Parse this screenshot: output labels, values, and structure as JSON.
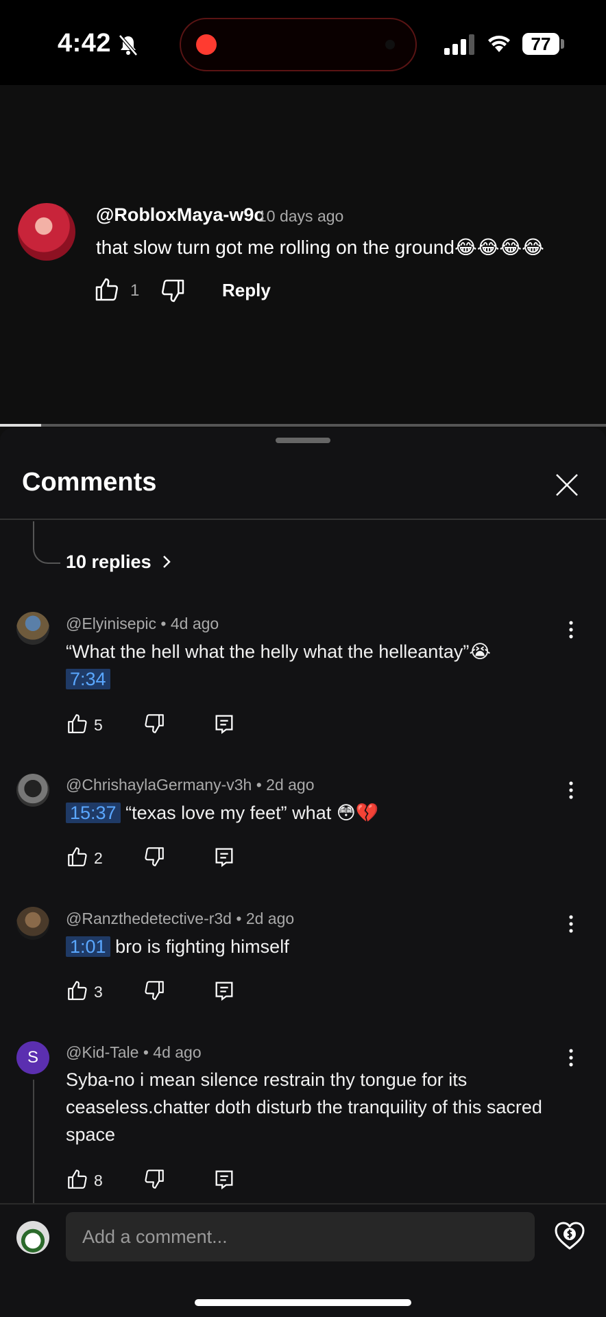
{
  "status_bar": {
    "time": "4:42",
    "battery": "77"
  },
  "video_comment": {
    "username": "@RobloxMaya-w9c",
    "time": "10 days ago",
    "text": "that slow turn got me rolling on the ground😂😂😂😂",
    "like_count": "1",
    "reply_label": "Reply"
  },
  "comments_sheet": {
    "title": "Comments",
    "replies_link": "10 replies",
    "comments": [
      {
        "username": "@Elyinisepic",
        "time": "4d ago",
        "text": "“What the hell what the helly what the helleantay”😭",
        "timestamp": "7:34",
        "likes": "5"
      },
      {
        "username": "@ChrishaylaGermany-v3h",
        "time": "2d ago",
        "timestamp": "15:37",
        "text": "“texas love my feet” what 😳💔",
        "likes": "2"
      },
      {
        "username": "@Ranzthedetective-r3d",
        "time": "2d ago",
        "timestamp": "1:01",
        "text": "bro is fighting himself",
        "likes": "3"
      },
      {
        "username": "@Kid-Tale",
        "time": "4d ago",
        "avatar_letter": "S",
        "text": "Syba-no i mean silence restrain thy tongue for its ceaseless.chatter doth disturb the tranquility of this sacred space",
        "likes": "8"
      }
    ]
  },
  "composer": {
    "placeholder": "Add a comment..."
  },
  "meta_separator": "•",
  "colors": {
    "timestamp_bg": "#1f3a66",
    "timestamp_fg": "#5aa7ff",
    "avatar_purple": "#5b2fb0"
  }
}
